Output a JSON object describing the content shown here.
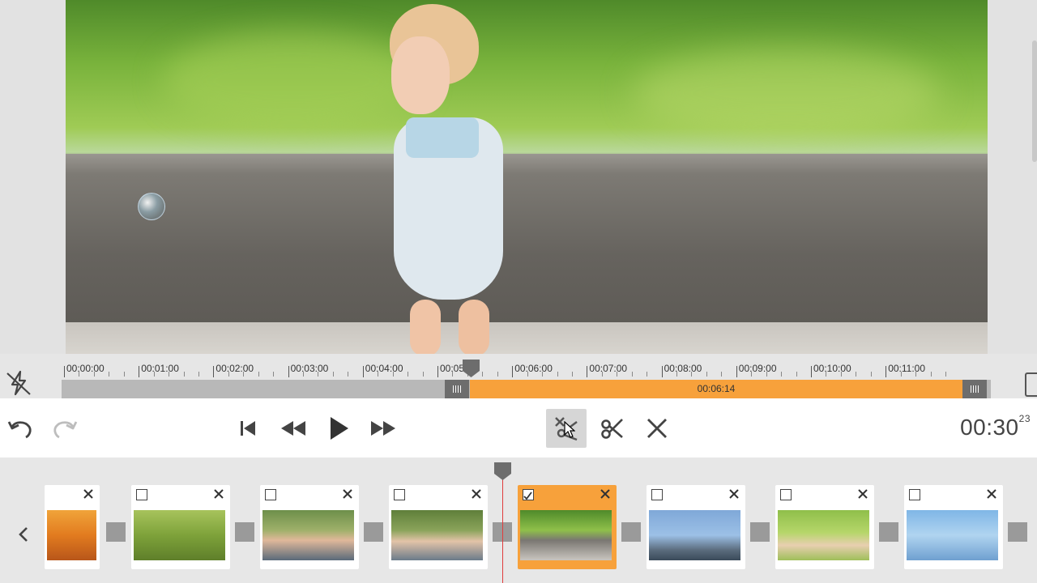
{
  "preview": {
    "description_visible": false
  },
  "ruler": {
    "labels": [
      "00:00:00",
      "00:01:00",
      "00:02:00",
      "00:03:00",
      "00:04:00",
      "00:05",
      "00:06:00",
      "00:07:00",
      "00:08:00",
      "00:09:00",
      "00:10:00",
      "00:11:00"
    ]
  },
  "selection": {
    "duration_label": "00:06:14"
  },
  "toolbar": {
    "undo": "undo-icon",
    "redo": "redo-icon",
    "skip_start": "skip-to-start-icon",
    "rewind": "rewind-icon",
    "play": "play-icon",
    "fast_forward": "fast-forward-icon",
    "cut_all": "cut-all-icon",
    "cut": "scissors-icon",
    "remove": "close-icon",
    "timecode": "00:30",
    "timecode_frames": "23"
  },
  "clips": [
    {
      "checked": false,
      "selected": false,
      "thumb": "sunset"
    },
    {
      "checked": false,
      "selected": false,
      "thumb": "meadow"
    },
    {
      "checked": false,
      "selected": false,
      "thumb": "bubbles-girl"
    },
    {
      "checked": false,
      "selected": false,
      "thumb": "bubbles-girl-2"
    },
    {
      "checked": true,
      "selected": true,
      "thumb": "child-park"
    },
    {
      "checked": false,
      "selected": false,
      "thumb": "river-fishing"
    },
    {
      "checked": false,
      "selected": false,
      "thumb": "blowing-bubbles"
    },
    {
      "checked": false,
      "selected": false,
      "thumb": "bubble-closeup"
    }
  ],
  "colors": {
    "accent": "#f7a13b",
    "track": "#b8b8b8",
    "handle": "#6d6d6d",
    "playhead": "#e03c3c"
  }
}
